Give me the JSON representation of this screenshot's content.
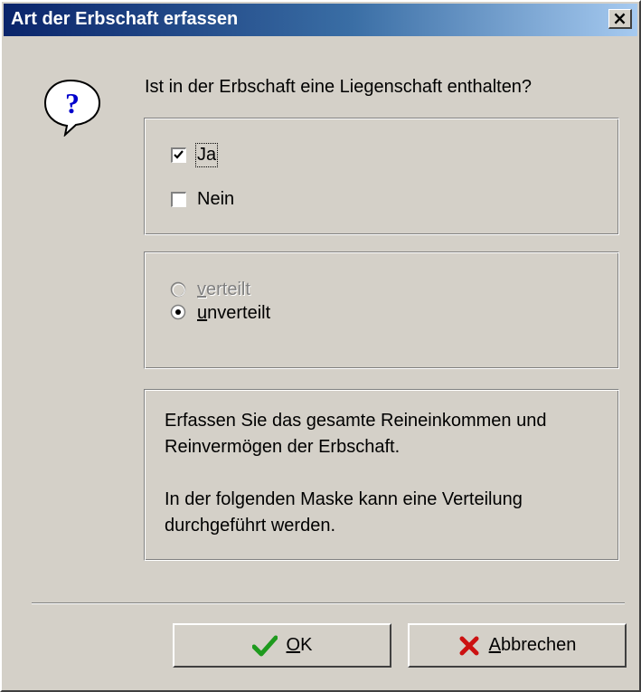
{
  "window": {
    "title": "Art der Erbschaft erfassen",
    "close_label": "×"
  },
  "question": "Ist in der Erbschaft eine Liegenschaft enthalten?",
  "property_group": {
    "options": [
      {
        "label": "Ja",
        "checked": true,
        "focused": true
      },
      {
        "label": "Nein",
        "checked": false
      }
    ]
  },
  "distribution_group": {
    "options": [
      {
        "label_ul": "v",
        "label_rest": "erteilt",
        "selected": false,
        "disabled": true
      },
      {
        "label_ul": "u",
        "label_rest": "nverteilt",
        "selected": true,
        "disabled": false
      }
    ]
  },
  "info": {
    "paragraph1": "Erfassen Sie das gesamte Reineinkommen und Reinvermögen der Erbschaft.",
    "paragraph2": "In der folgenden Maske kann eine Verteilung durchgeführt werden."
  },
  "buttons": {
    "ok": {
      "label_ul": "O",
      "label_rest": "K",
      "icon": "checkmark-icon",
      "icon_color": "#1e9a1e"
    },
    "cancel": {
      "label_ul": "A",
      "label_rest": "bbrechen",
      "icon": "x-icon",
      "icon_color": "#cc1111"
    }
  },
  "colors": {
    "title_gradient_start": "#0a246a",
    "dialog_background": "#d4d0c8"
  },
  "icons": {
    "dialog": "question-bubble-icon",
    "close": "close-icon"
  }
}
